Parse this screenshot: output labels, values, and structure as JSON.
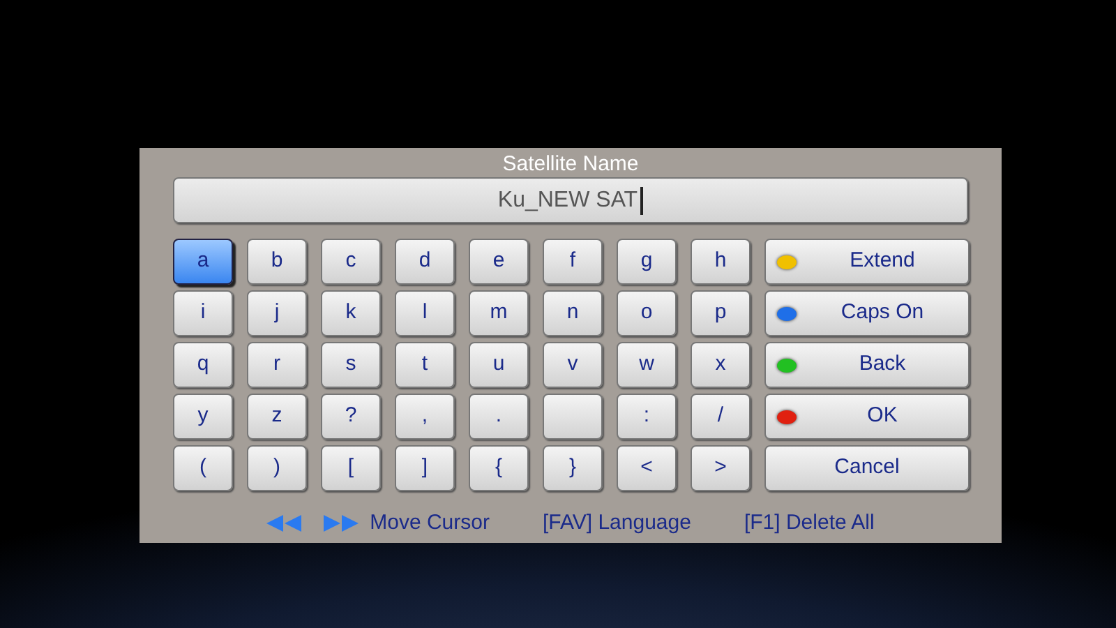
{
  "dialog": {
    "title": "Satellite Name",
    "value": "Ku_NEW SAT"
  },
  "keys": [
    [
      {
        "label": "a",
        "selected": true
      },
      {
        "label": "b",
        "selected": false
      },
      {
        "label": "c",
        "selected": false
      },
      {
        "label": "d",
        "selected": false
      },
      {
        "label": "e",
        "selected": false
      },
      {
        "label": "f",
        "selected": false
      },
      {
        "label": "g",
        "selected": false
      },
      {
        "label": "h",
        "selected": false
      }
    ],
    [
      {
        "label": "i",
        "selected": false
      },
      {
        "label": "j",
        "selected": false
      },
      {
        "label": "k",
        "selected": false
      },
      {
        "label": "l",
        "selected": false
      },
      {
        "label": "m",
        "selected": false
      },
      {
        "label": "n",
        "selected": false
      },
      {
        "label": "o",
        "selected": false
      },
      {
        "label": "p",
        "selected": false
      }
    ],
    [
      {
        "label": "q",
        "selected": false
      },
      {
        "label": "r",
        "selected": false
      },
      {
        "label": "s",
        "selected": false
      },
      {
        "label": "t",
        "selected": false
      },
      {
        "label": "u",
        "selected": false
      },
      {
        "label": "v",
        "selected": false
      },
      {
        "label": "w",
        "selected": false
      },
      {
        "label": "x",
        "selected": false
      }
    ],
    [
      {
        "label": "y",
        "selected": false
      },
      {
        "label": "z",
        "selected": false
      },
      {
        "label": "?",
        "selected": false
      },
      {
        "label": ",",
        "selected": false
      },
      {
        "label": ".",
        "selected": false
      },
      {
        "selected": false
      },
      {
        "label": ":",
        "selected": false
      },
      {
        "label": "/",
        "selected": false
      }
    ],
    [
      {
        "label": "(",
        "selected": false
      },
      {
        "label": ")",
        "selected": false
      },
      {
        "label": "[",
        "selected": false
      },
      {
        "label": "]",
        "selected": false
      },
      {
        "label": "{",
        "selected": false
      },
      {
        "label": "}",
        "selected": false
      },
      {
        "label": "<",
        "selected": false
      },
      {
        "label": ">",
        "selected": false
      }
    ]
  ],
  "actions": [
    {
      "label": "Extend",
      "color": "#f0c000",
      "selected": false
    },
    {
      "label": "Caps On",
      "color": "#1f6fe8",
      "selected": false
    },
    {
      "label": "Back",
      "color": "#22c022",
      "selected": false
    },
    {
      "label": "OK",
      "color": "#e02010",
      "selected": false
    },
    {
      "label": "Cancel",
      "selected": false
    }
  ],
  "footer": {
    "move_cursor": "Move Cursor",
    "language": "[FAV] Language",
    "delete_all": "[F1] Delete All"
  }
}
